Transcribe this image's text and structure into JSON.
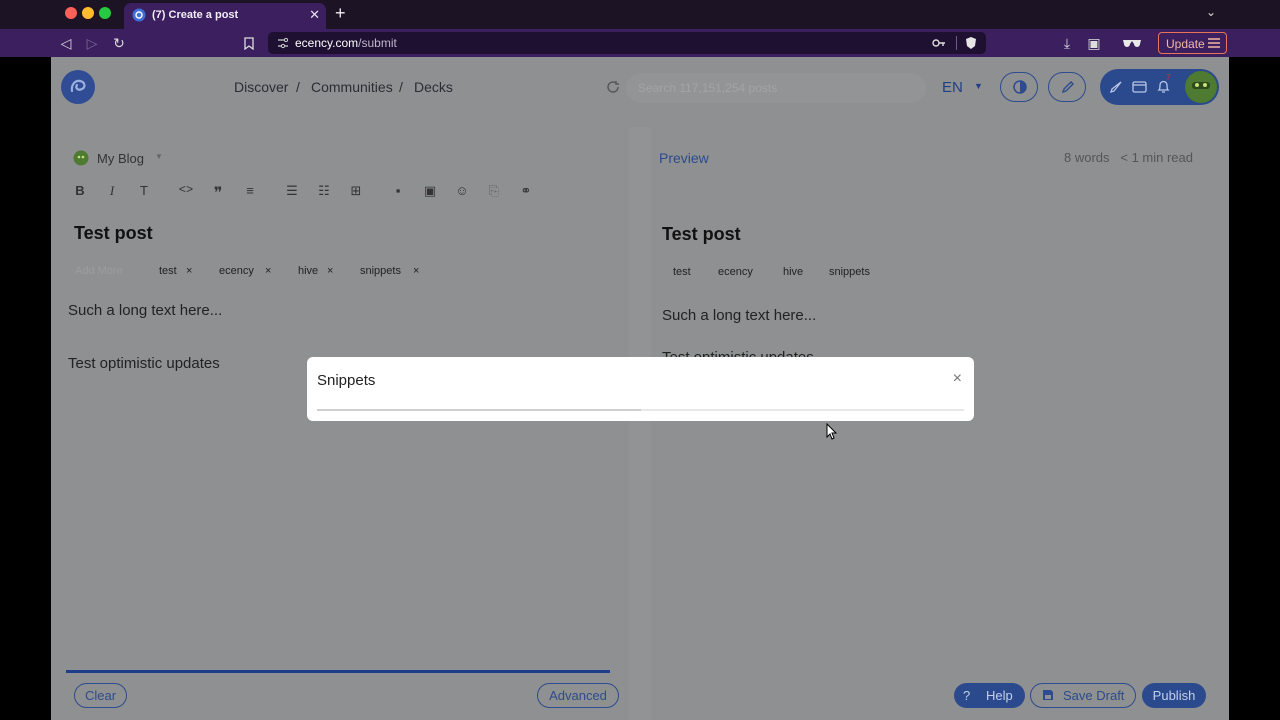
{
  "browser": {
    "tab_title": "(7) Create a post",
    "url_host": "ecency.com",
    "url_path": "/submit",
    "update_label": "Update"
  },
  "header": {
    "nav": [
      "Discover",
      "Communities",
      "Decks"
    ],
    "separator": "/",
    "search_placeholder": "Search 117,151,254 posts",
    "lang": "EN",
    "notification_count": "7"
  },
  "editor": {
    "blog_label": "My Blog",
    "title": "Test post",
    "add_more": "Add More",
    "tags": [
      "test",
      "ecency",
      "hive",
      "snippets"
    ],
    "tag_remove": "×",
    "body_lines": [
      "Such a long text here...",
      "Test optimistic updates"
    ],
    "clear_label": "Clear",
    "advanced_label": "Advanced"
  },
  "preview": {
    "label": "Preview",
    "words": "8 words",
    "read_time": "< 1 min read",
    "title": "Test post",
    "tags": [
      "test",
      "ecency",
      "hive",
      "snippets"
    ],
    "body_lines": [
      "Such a long text here...",
      "Test optimistic updates"
    ]
  },
  "actions": {
    "help_label": "Help",
    "save_draft_label": "Save Draft",
    "publish_label": "Publish"
  },
  "modal": {
    "title": "Snippets",
    "close": "×",
    "loading_progress_percent": 50
  },
  "colors": {
    "accent": "#2b4a8e",
    "tab_bg": "#3b1f5e",
    "update_border": "#e8735b"
  }
}
